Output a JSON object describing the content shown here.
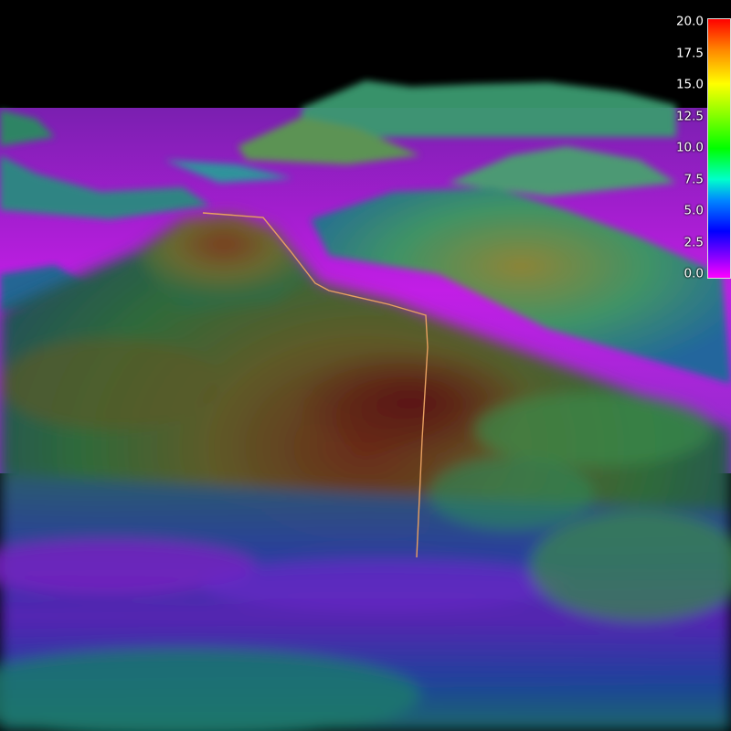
{
  "colorbar": {
    "ticks": [
      "20.0",
      "17.5",
      "15.0",
      "12.5",
      "10.0",
      "7.5",
      "5.0",
      "2.5",
      "0.0"
    ],
    "min": 0,
    "max": 20,
    "colormap": [
      "#ff0000",
      "#ff8800",
      "#ffff00",
      "#88ff00",
      "#00ff00",
      "#00ffcc",
      "#0088ff",
      "#0000ff",
      "#8800ff",
      "#ff00ff"
    ]
  },
  "colors": {
    "sky": "#000000",
    "track": "#e8a060"
  }
}
